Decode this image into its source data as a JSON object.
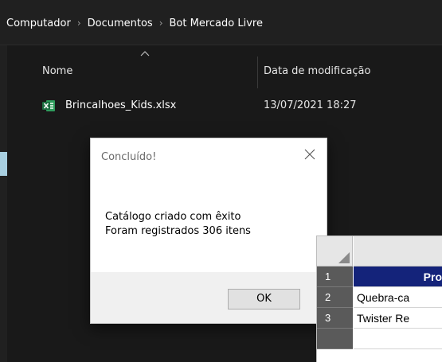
{
  "breadcrumb": {
    "items": [
      "Computador",
      "Documentos",
      "Bot Mercado Livre"
    ]
  },
  "file_list": {
    "columns": {
      "name": "Nome",
      "date": "Data de modificação"
    },
    "rows": [
      {
        "name": "Brincalhoes_Kids.xlsx",
        "date": "13/07/2021 18:27",
        "icon": "excel-file-icon"
      }
    ]
  },
  "dialog": {
    "title": "Concluído!",
    "message_line1": "Catálogo criado com êxito",
    "message_line2": "Foram registrados 306 itens",
    "ok_label": "OK"
  },
  "spreadsheet": {
    "header_cell": "Pro",
    "rows": [
      {
        "num": "1",
        "value": "Pro"
      },
      {
        "num": "2",
        "value": "Quebra-ca"
      },
      {
        "num": "3",
        "value": "Twister Re"
      }
    ]
  },
  "colors": {
    "explorer_bg": "#191919",
    "header_fill": "#14237a",
    "excel_green": "#1d6f42"
  }
}
